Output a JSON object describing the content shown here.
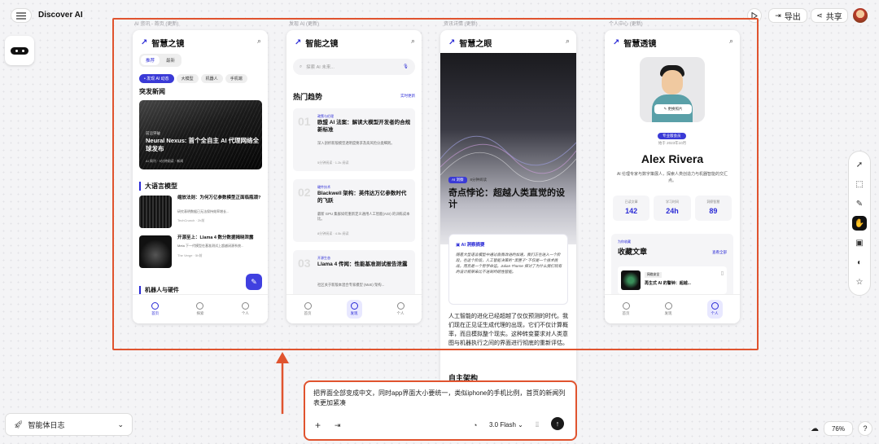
{
  "app": {
    "title": "Discover AI",
    "export_label": "导出",
    "share_label": "共享",
    "zoom": "76%",
    "help": "?",
    "agent_log": "智能体日志",
    "menu_icon": "menu-icon"
  },
  "frames": {
    "f1": {
      "label": "AI 资讯 - 首页 (更新)",
      "brand": "智慧之镜",
      "tabs": [
        "推荐",
        "最新"
      ],
      "chips": [
        "• 发现 AI 动态",
        "大模型",
        "机器人",
        "手机端"
      ],
      "section_breaking": "突发新闻",
      "hero_tag": "前沿突破",
      "hero_title": "Neural Nexus: 首个全自主 AI 代理网络全球发布",
      "hero_meta": "AI 周刊 · 5分钟阅读 · 新闻",
      "section_llm": "大语言模型",
      "items": [
        {
          "title": "缩放法则：为何万亿参数模型正面临瓶颈?",
          "desc": "研究表明数据已无法保持效率增长...",
          "meta": "TechCrunch · 2h前"
        },
        {
          "title": "开源至上：Llama 4 数分数据揭晓泄露",
          "desc": "Meta 下一代模型在基准测试上超越闭源系统...",
          "meta": "The Verge · 5h前"
        }
      ],
      "section_robot": "机器人与硬件",
      "nav": [
        "首页",
        "探索",
        "个人"
      ]
    },
    "f2": {
      "label": "发现 AI (更新)",
      "brand": "智能之镜",
      "search_placeholder": "探索 AI 未来...",
      "section": "热门趋势",
      "more": "实时更新",
      "cards": [
        {
          "num": "01",
          "tag": "政策与伦理",
          "title": "欧盟 AI 法案：解读大模型开发者的合规新标准",
          "desc": "深入剖析新版模型透明度要求及高风险分类细则。",
          "meta": "5分钟阅读 · 1.2k 阅读"
        },
        {
          "num": "02",
          "tag": "硬件技术",
          "title": "Blackwell 架构：英伟达万亿参数时代的飞跃",
          "desc": "最新 GPU 集群如何重新定义通用人工智能(AGI) 的训练成本比。",
          "meta": "8分钟阅读 · 4.5k 阅读"
        },
        {
          "num": "03",
          "tag": "开源生态",
          "title": "Llama 4 传闻：性能基准测试报告泄露",
          "desc": "社区关于新版本混合专家模型 (MoE) 架构...",
          "meta": ""
        }
      ],
      "nav": [
        "首页",
        "发现",
        "个人"
      ]
    },
    "f3": {
      "label": "资讯详情 (更新)",
      "brand": "智慧之眼",
      "tag": "AI 洞察",
      "read_time": "8分钟阅读",
      "title": "奇点悖论：超越人类直觉的设计",
      "insight_label": "AI 洞察摘要",
      "insight_text": "随着大型语言模型中通过自我改进的加速，我们正在进入一个阶段，在这个阶段，人工智能决策的 \"黑匣子\" 不仅是一个技术挑战，而且是一个哲学命运。Julian Thorne 探讨了为什么我们现有的设计框架来比不进到终结性智能。",
      "body": "人工智能的进化已经超越了仅仅预测的时代。我们现在正见证生成代理的出现，它们不仅计算概率，而且模拟整个现实。这种转变要求对人类意图与机器执行之间的界面进行彻底的重新评估。",
      "subhead": "自主架构"
    },
    "f4": {
      "label": "个人中心 (更新)",
      "brand": "智慧透镜",
      "change_avatar": "更换照片",
      "badge": "专业版会员",
      "joined": "始于 2023年10月",
      "name": "Alex Rivera",
      "bio": "AI 伦理专家与数字策展人，探索人类创造力与机器智能的交汇点。",
      "stats": [
        {
          "label": "已读文章",
          "value": "142"
        },
        {
          "label": "学习时间",
          "value": "24h"
        },
        {
          "label": "洞察智慧",
          "value": "89"
        }
      ],
      "fav_tag": "为你收藏",
      "fav_title": "收藏文章",
      "fav_more": "查看全部",
      "fav_item": "再生式 AI 的警钟：超越...",
      "fav_item_tag": "网络安全",
      "nav": [
        "首页",
        "发现",
        "个人"
      ]
    }
  },
  "prompt": {
    "text": "把界面全部变成中文，同时app界面大小要统一，类似iphone的手机比例，首页的新闻列表更加紧凑",
    "model": "3.0 Flash"
  },
  "colors": {
    "accent": "#2b2bd6",
    "annotation": "#e0532e"
  }
}
